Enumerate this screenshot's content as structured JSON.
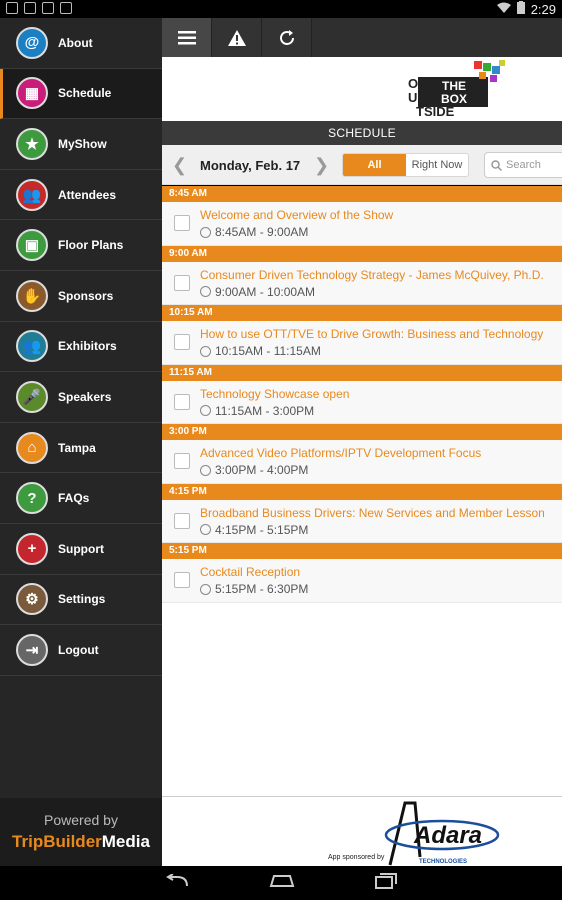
{
  "status_bar": {
    "time": "2:29"
  },
  "sidebar": {
    "items": [
      {
        "label": "About",
        "icon": "at-icon",
        "color": "#1b7fc4",
        "glyph": "@"
      },
      {
        "label": "Schedule",
        "icon": "calendar-icon",
        "color": "#c81e7a",
        "glyph": "▦"
      },
      {
        "label": "MyShow",
        "icon": "person-star-icon",
        "color": "#3d9a3f",
        "glyph": "★"
      },
      {
        "label": "Attendees",
        "icon": "group-icon",
        "color": "#c42a2a",
        "glyph": "👥"
      },
      {
        "label": "Floor Plans",
        "icon": "floorplan-icon",
        "color": "#3d9a3f",
        "glyph": "▣"
      },
      {
        "label": "Sponsors",
        "icon": "handshake-icon",
        "color": "#8a5a2b",
        "glyph": "✋"
      },
      {
        "label": "Exhibitors",
        "icon": "people-icon",
        "color": "#1f7e96",
        "glyph": "👥"
      },
      {
        "label": "Speakers",
        "icon": "microphone-icon",
        "color": "#5a8a2a",
        "glyph": "🎤"
      },
      {
        "label": "Tampa",
        "icon": "city-icon",
        "color": "#e8891e",
        "glyph": "⌂"
      },
      {
        "label": "FAQs",
        "icon": "question-icon",
        "color": "#3d9a3f",
        "glyph": "?"
      },
      {
        "label": "Support",
        "icon": "plus-icon",
        "color": "#c4262e",
        "glyph": "+"
      },
      {
        "label": "Settings",
        "icon": "gear-icon",
        "color": "#7a5a3a",
        "glyph": "⚙"
      },
      {
        "label": "Logout",
        "icon": "logout-icon",
        "color": "#666666",
        "glyph": "⇥"
      }
    ],
    "active_index": 1,
    "footer": {
      "powered_by": "Powered by",
      "brand_part1": "TripBuilder",
      "brand_part2": "Media"
    }
  },
  "toolbar": {
    "menu_icon": "menu-icon",
    "alert_icon": "alert-icon",
    "refresh_icon": "refresh-icon"
  },
  "logo": {
    "line_top": "THE",
    "line_mid": "BOX",
    "vertical": "OUT",
    "line_bottom": "TSIDE"
  },
  "header": {
    "title": "SCHEDULE"
  },
  "filter": {
    "date": "Monday, Feb. 17",
    "tabs": [
      "All",
      "Right Now"
    ],
    "selected_tab": "All",
    "search_placeholder": "Search"
  },
  "schedule": [
    {
      "time": "8:45 AM",
      "title": "Welcome and Overview of the Show",
      "range": "8:45AM - 9:00AM"
    },
    {
      "time": "9:00 AM",
      "title": "Consumer Driven Technology Strategy - James McQuivey, Ph.D.",
      "range": "9:00AM - 10:00AM"
    },
    {
      "time": "10:15 AM",
      "title": "How to use OTT/TVE to Drive Growth: Business and Technology",
      "range": "10:15AM - 11:15AM"
    },
    {
      "time": "11:15 AM",
      "title": "Technology Showcase open",
      "range": "11:15AM - 3:00PM"
    },
    {
      "time": "3:00 PM",
      "title": "Advanced Video Platforms/IPTV Development Focus",
      "range": "3:00PM - 4:00PM"
    },
    {
      "time": "4:15 PM",
      "title": "Broadband Business Drivers: New Services and Member Lesson",
      "range": "4:15PM - 5:15PM"
    },
    {
      "time": "5:15 PM",
      "title": "Cocktail Reception",
      "range": "5:15PM - 6:30PM"
    }
  ],
  "sponsor": {
    "by_text": "App sponsored by",
    "name": "Adara",
    "subtitle": "TECHNOLOGIES"
  },
  "colors": {
    "accent": "#e8891e",
    "sidebar_bg": "#262626"
  }
}
